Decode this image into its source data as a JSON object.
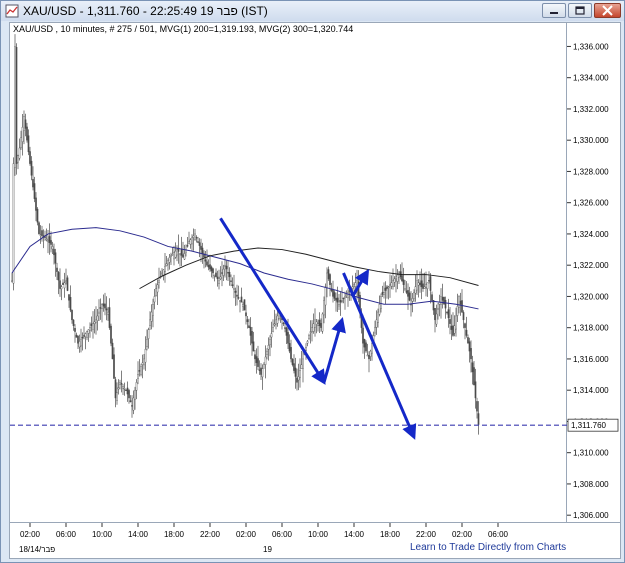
{
  "window": {
    "title": "XAU/USD - 1,311.760 - 22:25:49  19 פבר (IST)",
    "buttons": [
      "minimize",
      "restore",
      "close"
    ]
  },
  "chart_header": {
    "text": "XAU/USD , 10 minutes, # 275 / 501, MVG(1) 200=1,319.193, MVG(2) 300=1,320.744"
  },
  "footer": {
    "date_left": "18/14/פבר",
    "date_mid": "19",
    "watermark": "Learn to Trade Directly from Charts"
  },
  "colors": {
    "candle": "#4a4a4a",
    "mvg1": "#2b2b8f",
    "mvg2": "#202020",
    "arrow": "#1428c8",
    "price_line": "#3b3bb0"
  },
  "chart_data": {
    "type": "line",
    "title": "XAU/USD",
    "xlabel": "",
    "ylabel": "",
    "ylim": [
      1305.5,
      1337.5
    ],
    "yticks": [
      1306,
      1308,
      1310,
      1312,
      1314,
      1316,
      1318,
      1320,
      1322,
      1324,
      1326,
      1328,
      1330,
      1332,
      1334,
      1336
    ],
    "ytick_labels": [
      "1,306.000",
      "1,308.000",
      "1,310.000",
      "1,312.000",
      "1,314.000",
      "1,316.000",
      "1,318.000",
      "1,320.000",
      "1,322.000",
      "1,324.000",
      "1,326.000",
      "1,328.000",
      "1,330.000",
      "1,332.000",
      "1,334.000",
      "1,336.000"
    ],
    "xlim": [
      0,
      271
    ],
    "x_ticks": [
      12,
      36,
      60,
      84,
      108,
      132,
      156,
      180,
      204,
      228,
      252,
      276
    ],
    "x_tick_labels": [
      "02:00",
      "06:00",
      "10:00",
      "14:00",
      "18:00",
      "22:00",
      "02:00",
      "06:00",
      "10:00",
      "14:00",
      "18:00",
      "22:00",
      "02:00",
      "06:00"
    ],
    "x_tick_index": [
      12,
      36,
      60,
      84,
      108,
      132,
      156,
      180,
      204,
      228,
      252,
      276,
      300,
      324
    ],
    "price_anchors": [
      [
        0,
        1321
      ],
      [
        2,
        1336
      ],
      [
        3,
        1328.5
      ],
      [
        5,
        1329.5
      ],
      [
        8,
        1331.5
      ],
      [
        10,
        1330
      ],
      [
        14,
        1327
      ],
      [
        18,
        1324
      ],
      [
        22,
        1323.8
      ],
      [
        27,
        1323.2
      ],
      [
        32,
        1320.5
      ],
      [
        36,
        1321
      ],
      [
        40,
        1318.5
      ],
      [
        44,
        1317
      ],
      [
        48,
        1317.5
      ],
      [
        52,
        1318
      ],
      [
        56,
        1318.5
      ],
      [
        60,
        1319.5
      ],
      [
        64,
        1319
      ],
      [
        67,
        1316
      ],
      [
        69,
        1313.5
      ],
      [
        72,
        1314.5
      ],
      [
        76,
        1314
      ],
      [
        80,
        1313
      ],
      [
        84,
        1315
      ],
      [
        88,
        1316
      ],
      [
        92,
        1318.5
      ],
      [
        96,
        1320.5
      ],
      [
        100,
        1321.5
      ],
      [
        105,
        1322.5
      ],
      [
        110,
        1323
      ],
      [
        114,
        1322.5
      ],
      [
        118,
        1323.5
      ],
      [
        122,
        1324
      ],
      [
        126,
        1323
      ],
      [
        130,
        1322
      ],
      [
        134,
        1321.5
      ],
      [
        138,
        1321
      ],
      [
        142,
        1322
      ],
      [
        146,
        1321
      ],
      [
        150,
        1320
      ],
      [
        154,
        1319.5
      ],
      [
        158,
        1318
      ],
      [
        162,
        1316
      ],
      [
        166,
        1315
      ],
      [
        170,
        1316.5
      ],
      [
        174,
        1318
      ],
      [
        178,
        1319
      ],
      [
        182,
        1318
      ],
      [
        186,
        1316
      ],
      [
        190,
        1314.5
      ],
      [
        194,
        1316
      ],
      [
        198,
        1317.5
      ],
      [
        202,
        1318.5
      ],
      [
        206,
        1318
      ],
      [
        210,
        1321.5
      ],
      [
        214,
        1320
      ],
      [
        218,
        1319.5
      ],
      [
        222,
        1320
      ],
      [
        226,
        1320.5
      ],
      [
        230,
        1321
      ],
      [
        234,
        1317
      ],
      [
        238,
        1316
      ],
      [
        242,
        1318
      ],
      [
        246,
        1320
      ],
      [
        250,
        1320.5
      ],
      [
        254,
        1321
      ],
      [
        258,
        1321.5
      ],
      [
        262,
        1320.5
      ],
      [
        266,
        1319.5
      ],
      [
        270,
        1321
      ],
      [
        274,
        1320.5
      ],
      [
        278,
        1321
      ],
      [
        282,
        1318.5
      ],
      [
        286,
        1320
      ],
      [
        290,
        1319
      ],
      [
        294,
        1317.5
      ],
      [
        298,
        1320
      ],
      [
        302,
        1318
      ],
      [
        306,
        1316
      ],
      [
        309,
        1313.5
      ],
      [
        311,
        1311.8
      ]
    ],
    "series": [
      {
        "name": "MVG(1) 200",
        "values": [
          [
            0,
            1321.5
          ],
          [
            12,
            1323.2
          ],
          [
            24,
            1324
          ],
          [
            40,
            1324.3
          ],
          [
            56,
            1324.4
          ],
          [
            72,
            1324.2
          ],
          [
            88,
            1323.8
          ],
          [
            104,
            1323.2
          ],
          [
            120,
            1322.9
          ],
          [
            136,
            1322.5
          ],
          [
            152,
            1322.1
          ],
          [
            168,
            1321.5
          ],
          [
            184,
            1321.1
          ],
          [
            200,
            1320.8
          ],
          [
            216,
            1320.4
          ],
          [
            232,
            1319.9
          ],
          [
            248,
            1319.5
          ],
          [
            264,
            1319.5
          ],
          [
            280,
            1319.7
          ],
          [
            296,
            1319.5
          ],
          [
            311,
            1319.2
          ]
        ]
      },
      {
        "name": "MVG(2) 300",
        "values": [
          [
            85,
            1320.5
          ],
          [
            100,
            1321.3
          ],
          [
            116,
            1322
          ],
          [
            132,
            1322.6
          ],
          [
            148,
            1322.9
          ],
          [
            164,
            1323.1
          ],
          [
            180,
            1323
          ],
          [
            196,
            1322.7
          ],
          [
            212,
            1322.3
          ],
          [
            228,
            1321.9
          ],
          [
            244,
            1321.6
          ],
          [
            260,
            1321.4
          ],
          [
            276,
            1321.4
          ],
          [
            292,
            1321.2
          ],
          [
            311,
            1320.7
          ]
        ]
      }
    ],
    "last_price": 1311.76,
    "last_price_label": "1,311.760",
    "arrows": [
      {
        "from": [
          139,
          1325
        ],
        "to": [
          208,
          1314.5
        ]
      },
      {
        "from": [
          208,
          1314.5
        ],
        "to": [
          220,
          1318.5
        ]
      },
      {
        "from": [
          227,
          1320
        ],
        "to": [
          237,
          1321.6
        ]
      },
      {
        "from": [
          221,
          1321.5
        ],
        "to": [
          268,
          1311
        ]
      }
    ],
    "grid": false,
    "legend": "none"
  }
}
